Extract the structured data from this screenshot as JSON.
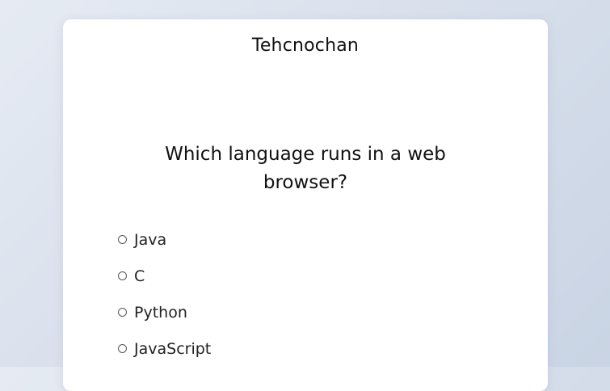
{
  "quiz": {
    "title": "Tehcnochan",
    "question": "Which language runs in a web browser?",
    "answers": [
      {
        "label": "Java"
      },
      {
        "label": "C"
      },
      {
        "label": "Python"
      },
      {
        "label": "JavaScript"
      }
    ]
  }
}
